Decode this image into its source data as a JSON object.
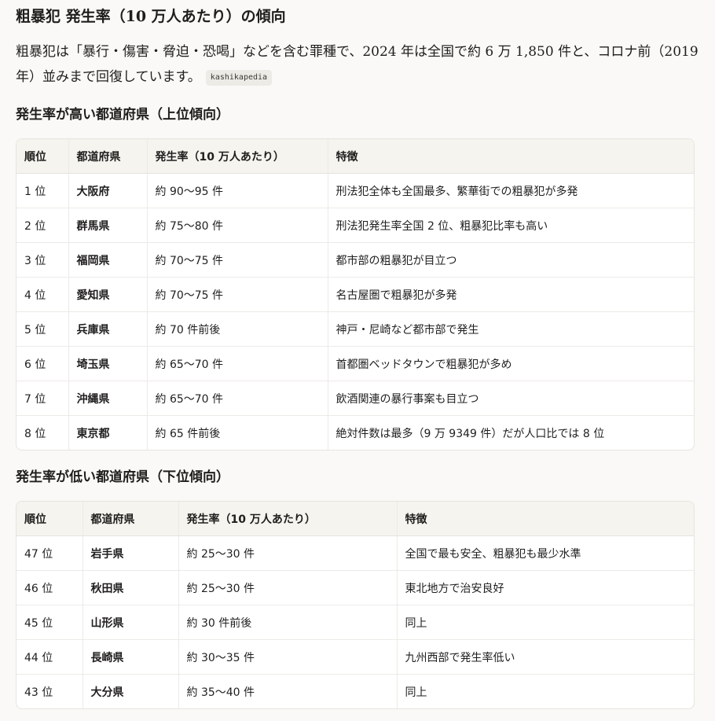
{
  "title": "粗暴犯 発生率（10 万人あたり）の傾向",
  "intro": {
    "text": "粗暴犯は「暴行・傷害・脅迫・恐喝」などを含む罪種で、2024 年は全国で約 6 万 1,850 件と、コロナ前（2019 年）並みまで回復しています。",
    "source": "kashikapedia"
  },
  "top_section": {
    "heading": "発生率が高い都道府県（上位傾向）",
    "headers": [
      "順位",
      "都道府県",
      "発生率（10 万人あたり）",
      "特徴"
    ],
    "rows": [
      [
        "1 位",
        "大阪府",
        "約 90〜95 件",
        "刑法犯全体も全国最多、繁華街での粗暴犯が多発"
      ],
      [
        "2 位",
        "群馬県",
        "約 75〜80 件",
        "刑法犯発生率全国 2 位、粗暴犯比率も高い"
      ],
      [
        "3 位",
        "福岡県",
        "約 70〜75 件",
        "都市部の粗暴犯が目立つ"
      ],
      [
        "4 位",
        "愛知県",
        "約 70〜75 件",
        "名古屋圏で粗暴犯が多発"
      ],
      [
        "5 位",
        "兵庫県",
        "約 70 件前後",
        "神戸・尼崎など都市部で発生"
      ],
      [
        "6 位",
        "埼玉県",
        "約 65〜70 件",
        "首都圏ベッドタウンで粗暴犯が多め"
      ],
      [
        "7 位",
        "沖縄県",
        "約 65〜70 件",
        "飲酒関連の暴行事案も目立つ"
      ],
      [
        "8 位",
        "東京都",
        "約 65 件前後",
        "絶対件数は最多（9 万 9349 件）だが人口比では 8 位"
      ]
    ]
  },
  "bottom_section": {
    "heading": "発生率が低い都道府県（下位傾向）",
    "headers": [
      "順位",
      "都道府県",
      "発生率（10 万人あたり）",
      "特徴"
    ],
    "rows": [
      [
        "47 位",
        "岩手県",
        "約 25〜30 件",
        "全国で最も安全、粗暴犯も最少水準"
      ],
      [
        "46 位",
        "秋田県",
        "約 25〜30 件",
        "東北地方で治安良好"
      ],
      [
        "45 位",
        "山形県",
        "約 30 件前後",
        "同上"
      ],
      [
        "44 位",
        "長崎県",
        "約 30〜35 件",
        "九州西部で発生率低い"
      ],
      [
        "43 位",
        "大分県",
        "約 35〜40 件",
        "同上"
      ]
    ]
  }
}
